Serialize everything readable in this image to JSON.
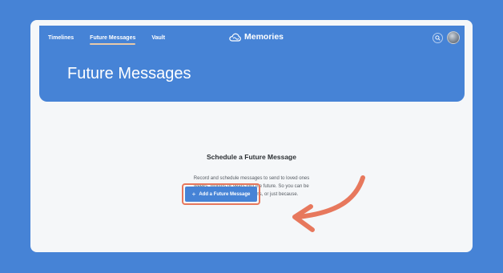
{
  "nav": {
    "items": [
      {
        "label": "Timelines",
        "active": false
      },
      {
        "label": "Future Messages",
        "active": true
      },
      {
        "label": "Vault",
        "active": false
      }
    ]
  },
  "brand": {
    "name": "Memories",
    "icon": "cloud-icon"
  },
  "header_actions": {
    "search_icon": "search-icon",
    "avatar": "user-avatar"
  },
  "page": {
    "title": "Future Messages"
  },
  "empty_state": {
    "title": "Schedule a Future Message",
    "desc_line1": "Record and schedule messages to send to loved ones",
    "desc_line2": "weeks, months or years into the future. So you can be",
    "desc_line3": "there for special occasions, or just because.",
    "cta_label": "Add a Future Message",
    "cta_icon": "plus-icon"
  },
  "colors": {
    "brand_blue": "#4683d6",
    "annotation_orange": "#e7785d",
    "panel_bg": "#f5f7f9"
  }
}
